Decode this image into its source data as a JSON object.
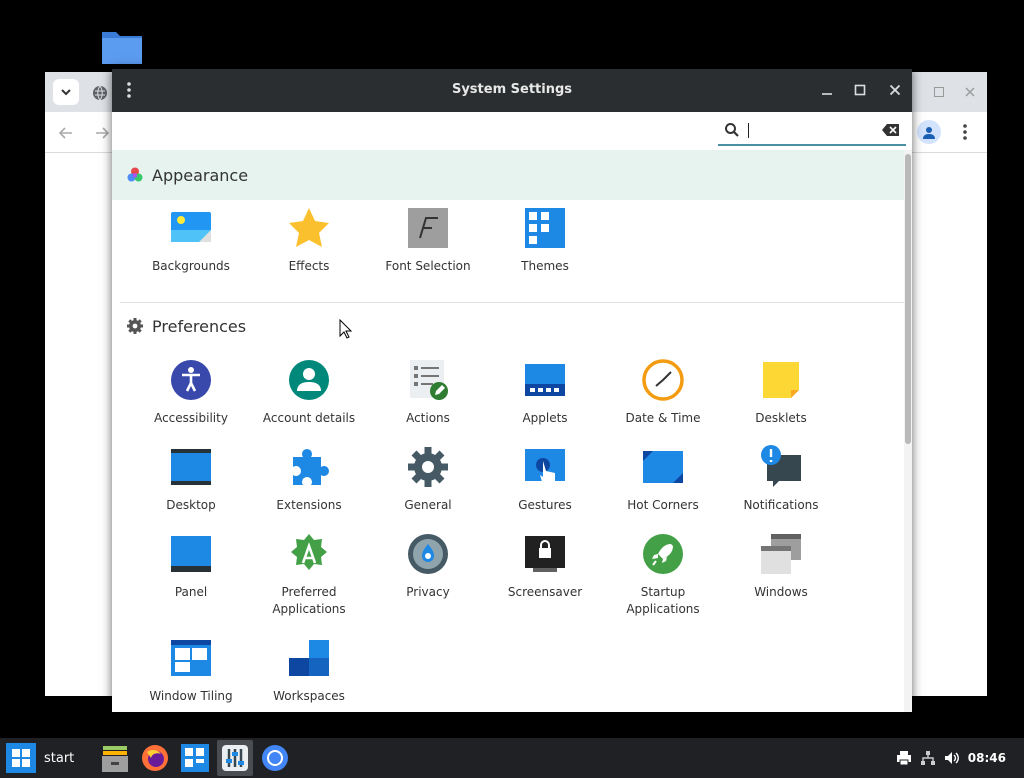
{
  "settings_window": {
    "title": "System Settings",
    "search": {
      "value": "",
      "placeholder": ""
    },
    "sections": [
      {
        "title": "Appearance",
        "items": [
          {
            "label": "Backgrounds",
            "icon": "backgrounds-icon"
          },
          {
            "label": "Effects",
            "icon": "star-icon"
          },
          {
            "label": "Font Selection",
            "icon": "font-icon"
          },
          {
            "label": "Themes",
            "icon": "themes-grid-icon"
          }
        ]
      },
      {
        "title": "Preferences",
        "items": [
          {
            "label": "Accessibility",
            "icon": "accessibility-icon"
          },
          {
            "label": "Account details",
            "icon": "account-icon"
          },
          {
            "label": "Actions",
            "icon": "actions-icon"
          },
          {
            "label": "Applets",
            "icon": "applets-icon"
          },
          {
            "label": "Date & Time",
            "icon": "clock-icon"
          },
          {
            "label": "Desklets",
            "icon": "sticky-note-icon"
          },
          {
            "label": "Desktop",
            "icon": "desktop-icon"
          },
          {
            "label": "Extensions",
            "icon": "puzzle-icon"
          },
          {
            "label": "General",
            "icon": "gear-icon"
          },
          {
            "label": "Gestures",
            "icon": "gestures-icon"
          },
          {
            "label": "Hot Corners",
            "icon": "hot-corners-icon"
          },
          {
            "label": "Notifications",
            "icon": "notification-icon"
          },
          {
            "label": "Panel",
            "icon": "panel-icon"
          },
          {
            "label": "Preferred Applications",
            "label_lines": [
              "Preferred",
              "Applications"
            ],
            "icon": "preferred-apps-icon"
          },
          {
            "label": "Privacy",
            "icon": "privacy-icon"
          },
          {
            "label": "Screensaver",
            "icon": "screensaver-icon"
          },
          {
            "label": "Startup Applications",
            "label_lines": [
              "Startup",
              "Applications"
            ],
            "icon": "rocket-icon"
          },
          {
            "label": "Windows",
            "icon": "windows-icon"
          },
          {
            "label": "Window Tiling",
            "icon": "window-tiling-icon"
          },
          {
            "label": "Workspaces",
            "icon": "workspaces-icon"
          }
        ]
      }
    ]
  },
  "taskbar": {
    "start_label": "start",
    "clock": "08:46",
    "apps": [
      "file-manager-icon",
      "firefox-icon",
      "app-grid-icon",
      "settings-app-icon",
      "chromium-icon"
    ]
  },
  "colors": {
    "titlebar": "#2b2e30",
    "appearance_header_bg": "#e6f3ef",
    "accent": "#1e88e5",
    "taskbar": "#1f2124"
  }
}
